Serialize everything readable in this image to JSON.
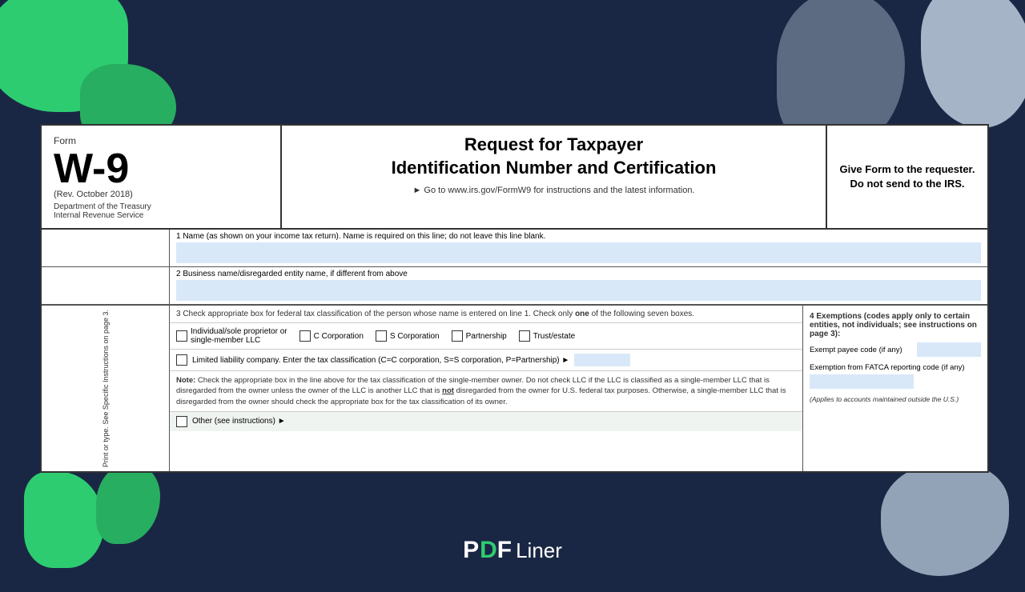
{
  "background": {
    "color": "#1a2744"
  },
  "form": {
    "header": {
      "form_label": "Form",
      "form_number": "W-9",
      "rev_date": "(Rev. October 2018)",
      "dept": "Department of the Treasury",
      "irs": "Internal Revenue Service",
      "main_title_line1": "Request for Taxpayer",
      "main_title_line2": "Identification Number and Certification",
      "irs_link": "► Go to www.irs.gov/FormW9 for instructions and the latest information.",
      "give_form": "Give Form to the requester. Do not send to the IRS."
    },
    "line1": {
      "label": "1  Name (as shown on your income tax return). Name is required on this line; do not leave this line blank."
    },
    "line2": {
      "label": "2  Business name/disregarded entity name, if different from above"
    },
    "line3": {
      "label_start": "3  Check appropriate box for federal tax classification of the person whose name is entered on line 1. Check only ",
      "label_bold": "one",
      "label_end": " of the following seven boxes.",
      "checkboxes": [
        {
          "id": "individual",
          "label": "Individual/sole proprietor or\nsingle-member LLC"
        },
        {
          "id": "c_corp",
          "label": "C Corporation"
        },
        {
          "id": "s_corp",
          "label": "S Corporation"
        },
        {
          "id": "partnership",
          "label": "Partnership"
        },
        {
          "id": "trust",
          "label": "Trust/estate"
        }
      ],
      "llc_label": "Limited liability company. Enter the tax classification (C=C corporation, S=S corporation, P=Partnership) ►",
      "note_bold": "Note:",
      "note_text": " Check the appropriate box in the line above for the tax classification of the single-member owner.  Do not check LLC if the LLC is classified as a single-member LLC that is disregarded from the owner unless the owner of the LLC is another LLC that is ",
      "note_not": "not",
      "note_text2": " disregarded from the owner for U.S. federal tax purposes. Otherwise, a single-member LLC that is disregarded from the owner should check the appropriate box for the tax classification of its owner.",
      "other_label": "Other (see instructions) ►"
    },
    "line4": {
      "title": "4  Exemptions (codes apply only to certain entities, not individuals; see instructions on page 3):",
      "exempt_payee_label": "Exempt payee code (if any)",
      "fatca_label": "Exemption from FATCA reporting\ncode (if any)",
      "fatca_note": "(Applies to accounts maintained outside the U.S.)"
    },
    "side_text": "Print or type. See Specific Instructions on page 3."
  },
  "logo": {
    "pdf": "PDF",
    "liner": "Liner"
  }
}
